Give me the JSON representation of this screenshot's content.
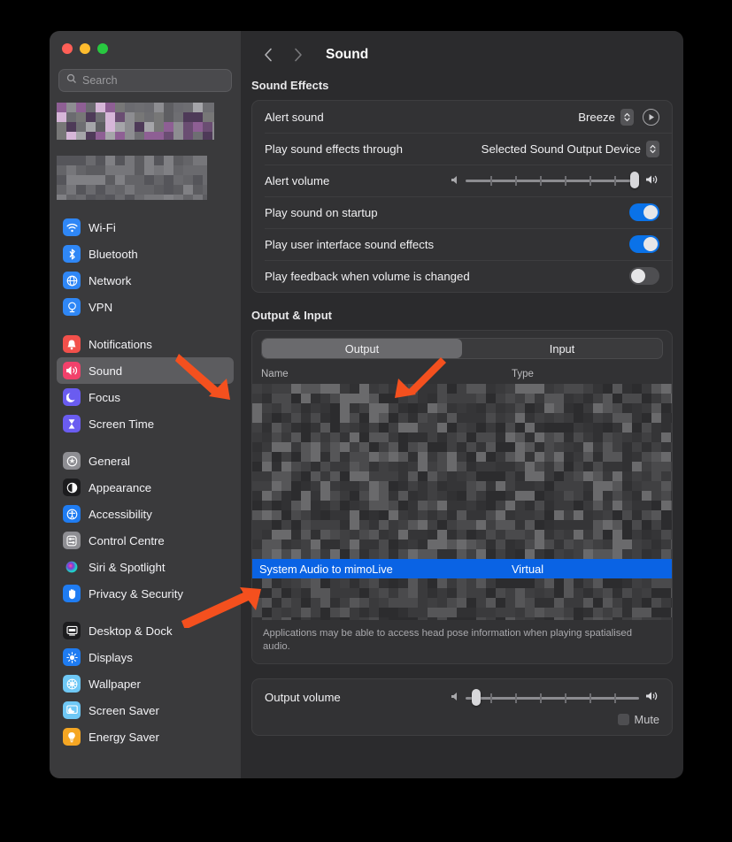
{
  "window": {
    "traffic_lights": [
      "close",
      "minimize",
      "zoom"
    ],
    "colors": {
      "close": "#ff5f57",
      "minimize": "#febc2e",
      "zoom": "#28c840",
      "accent": "#0a72e8",
      "selection": "#0a63e4",
      "annotation": "#f4501e"
    }
  },
  "sidebar": {
    "search": {
      "placeholder": "Search",
      "value": ""
    },
    "redacted_profile": true,
    "groups": [
      {
        "items": [
          {
            "label": "Wi-Fi",
            "icon": "wifi-icon",
            "icon_color": "#2f87f6",
            "selected": false
          },
          {
            "label": "Bluetooth",
            "icon": "bluetooth-icon",
            "icon_color": "#2f87f6",
            "selected": false
          },
          {
            "label": "Network",
            "icon": "globe-icon",
            "icon_color": "#2f87f6",
            "selected": false
          },
          {
            "label": "VPN",
            "icon": "vpn-icon",
            "icon_color": "#2f87f6",
            "selected": false
          }
        ]
      },
      {
        "items": [
          {
            "label": "Notifications",
            "icon": "bell-icon",
            "icon_color": "#f2504b",
            "selected": false
          },
          {
            "label": "Sound",
            "icon": "speaker-icon",
            "icon_color": "#f2416b",
            "selected": true
          },
          {
            "label": "Focus",
            "icon": "moon-icon",
            "icon_color": "#6a5cf0",
            "selected": false
          },
          {
            "label": "Screen Time",
            "icon": "hourglass-icon",
            "icon_color": "#6a5cf0",
            "selected": false
          }
        ]
      },
      {
        "items": [
          {
            "label": "General",
            "icon": "gear-icon",
            "icon_color": "#8e8e93",
            "selected": false
          },
          {
            "label": "Appearance",
            "icon": "appearance-icon",
            "icon_color": "#1c1c1e",
            "selected": false
          },
          {
            "label": "Accessibility",
            "icon": "accessibility-icon",
            "icon_color": "#1f7cf2",
            "selected": false
          },
          {
            "label": "Control Centre",
            "icon": "control-centre-icon",
            "icon_color": "#8e8e93",
            "selected": false
          },
          {
            "label": "Siri & Spotlight",
            "icon": "siri-icon",
            "icon_color": "#4a3a7a",
            "selected": false
          },
          {
            "label": "Privacy & Security",
            "icon": "hand-icon",
            "icon_color": "#1f7cf2",
            "selected": false
          }
        ]
      },
      {
        "items": [
          {
            "label": "Desktop & Dock",
            "icon": "desktop-dock-icon",
            "icon_color": "#1c1c1e",
            "selected": false
          },
          {
            "label": "Displays",
            "icon": "display-icon",
            "icon_color": "#1f7cf2",
            "selected": false
          },
          {
            "label": "Wallpaper",
            "icon": "wallpaper-icon",
            "icon_color": "#6fc8f5",
            "selected": false
          },
          {
            "label": "Screen Saver",
            "icon": "screen-saver-icon",
            "icon_color": "#6fc8f5",
            "selected": false
          },
          {
            "label": "Energy Saver",
            "icon": "bulb-icon",
            "icon_color": "#f5a623",
            "selected": false
          }
        ]
      }
    ]
  },
  "toolbar": {
    "back": "‹",
    "forward": "›",
    "title": "Sound"
  },
  "sound_effects": {
    "section_title": "Sound Effects",
    "rows": [
      {
        "label": "Alert sound",
        "type": "popup",
        "value": "Breeze",
        "has_play_button": true
      },
      {
        "label": "Play sound effects through",
        "type": "popup",
        "value": "Selected Sound Output Device",
        "has_play_button": false
      },
      {
        "label": "Alert volume",
        "type": "slider",
        "value": 100,
        "ticks": 6
      },
      {
        "label": "Play sound on startup",
        "type": "toggle",
        "value": "on"
      },
      {
        "label": "Play user interface sound effects",
        "type": "toggle",
        "value": "on"
      },
      {
        "label": "Play feedback when volume is changed",
        "type": "toggle",
        "value": "off"
      }
    ]
  },
  "output_input": {
    "section_title": "Output & Input",
    "tabs": [
      {
        "label": "Output",
        "active": true
      },
      {
        "label": "Input",
        "active": false
      }
    ],
    "table": {
      "columns": [
        "Name",
        "Type"
      ],
      "redacted_rows_above": 9,
      "selected_row": {
        "name": "System Audio to mimoLive",
        "type": "Virtual"
      },
      "redacted_rows_below": 3
    },
    "spatial_note": "Applications may be able to access head pose information when playing spatialised audio."
  },
  "output_volume": {
    "label": "Output volume",
    "slider_value": 4,
    "ticks": 6,
    "mute": {
      "label": "Mute",
      "checked": false
    }
  },
  "annotations": [
    {
      "name": "arrow-to-sound-sidebar-item",
      "color": "#f4501e"
    },
    {
      "name": "arrow-to-output-tab",
      "color": "#f4501e"
    },
    {
      "name": "arrow-to-selected-device-row",
      "color": "#f4501e"
    }
  ]
}
